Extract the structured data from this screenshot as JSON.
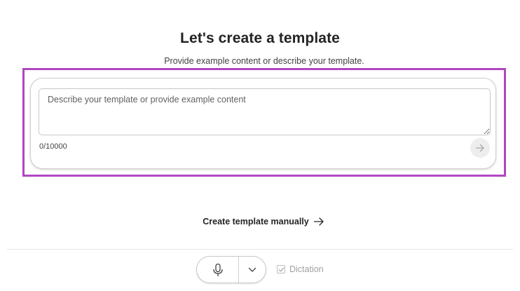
{
  "header": {
    "title": "Let's create a template",
    "subtitle": "Provide example content or describe your template."
  },
  "prompt": {
    "placeholder": "Describe your template or provide example content",
    "value": "",
    "char_count": "0/10000",
    "send_icon": "arrow-right-icon"
  },
  "manual": {
    "label": "Create template manually",
    "icon": "arrow-right-icon"
  },
  "dictation": {
    "mic_icon": "microphone-icon",
    "chevron_icon": "chevron-down-icon",
    "label": "Dictation",
    "checked": true
  },
  "colors": {
    "highlight": "#b146c2",
    "text": "#242424",
    "muted": "#a0a0a0"
  }
}
